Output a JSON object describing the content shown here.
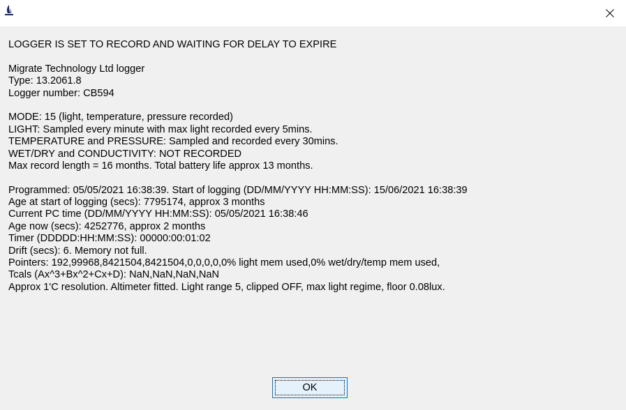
{
  "window": {
    "icon": "migrate-logo-icon",
    "close_icon": "close-icon"
  },
  "message": {
    "status": "LOGGER IS SET TO RECORD AND WAITING FOR DELAY TO EXPIRE",
    "device": [
      "Migrate Technology Ltd logger",
      "Type: 13.2061.8",
      "Logger number: CB594"
    ],
    "config": [
      "MODE: 15 (light, temperature, pressure recorded)",
      "LIGHT: Sampled every minute with max light recorded every 5mins.",
      "TEMPERATURE and PRESSURE: Sampled and recorded every 30mins.",
      "WET/DRY and CONDUCTIVITY: NOT RECORDED",
      "Max record length = 16 months. Total battery life approx 13 months."
    ],
    "details": [
      "Programmed: 05/05/2021 16:38:39. Start of logging (DD/MM/YYYY HH:MM:SS): 15/06/2021 16:38:39",
      "Age at start of logging (secs): 7795174, approx 3 months",
      "Current PC time (DD/MM/YYYY HH:MM:SS): 05/05/2021 16:38:46",
      "Age now (secs): 4252776, approx 2 months",
      "Timer (DDDDD:HH:MM:SS): 00000:00:01:02",
      "Drift (secs): 6. Memory not full.",
      "Pointers: 192,99968,8421504,8421504,0,0,0,0,0% light mem used,0% wet/dry/temp mem used,",
      "Tcals (Ax^3+Bx^2+Cx+D): NaN,NaN,NaN,NaN",
      "Approx 1'C resolution. Altimeter fitted. Light range 5, clipped OFF, max light regime, floor 0.08lux."
    ]
  },
  "buttons": {
    "ok_label": "OK"
  }
}
